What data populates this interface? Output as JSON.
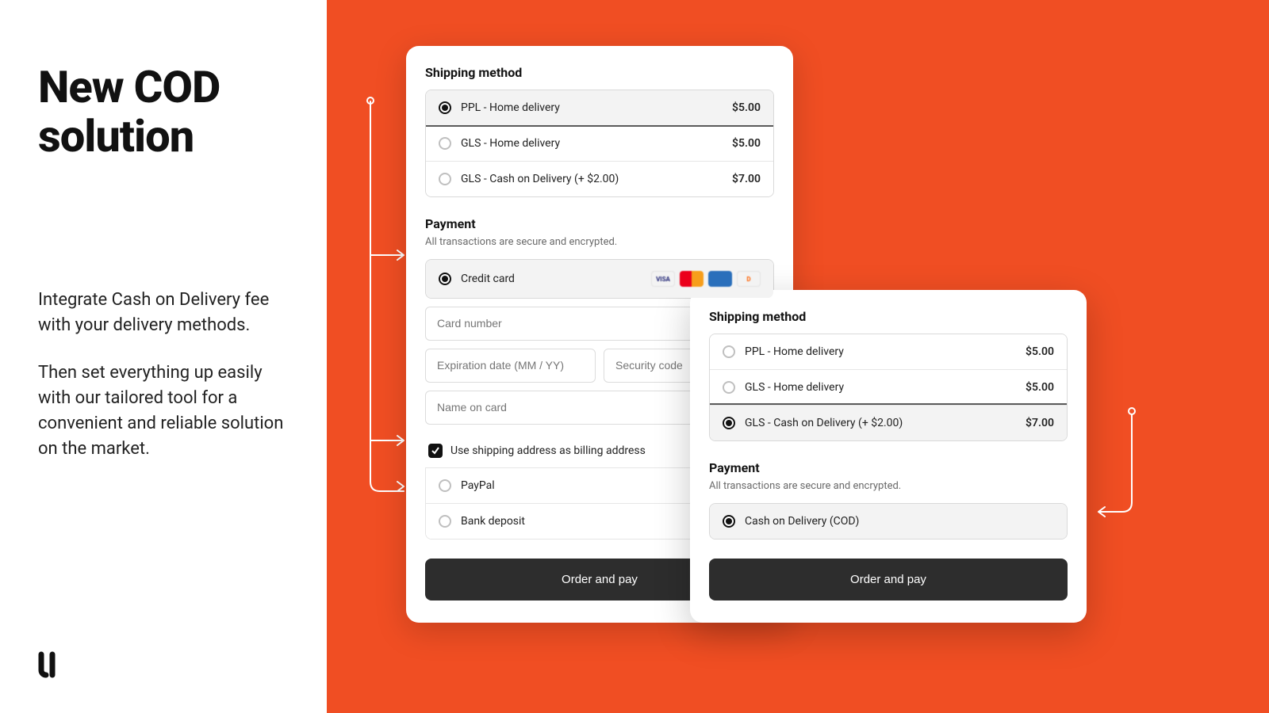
{
  "left": {
    "headline": "New COD solution",
    "p1": "Integrate Cash on Delivery fee with your delivery methods.",
    "p2": "Then set everything up easily with our tailored tool for a convenient and reliable solution on the market."
  },
  "cardA": {
    "shipping_title": "Shipping method",
    "shipping": [
      {
        "label": "PPL - Home delivery",
        "price": "$5.00",
        "selected": true
      },
      {
        "label": "GLS - Home delivery",
        "price": "$5.00",
        "selected": false
      },
      {
        "label": "GLS - Cash on Delivery (+ $2.00)",
        "price": "$7.00",
        "selected": false
      }
    ],
    "payment_title": "Payment",
    "payment_sub": "All transactions are secure and encrypted.",
    "cc_label": "Credit card",
    "fields": {
      "card_number": "Card number",
      "exp": "Expiration date (MM / YY)",
      "cvv": "Security code",
      "name": "Name on card"
    },
    "chk_label": "Use shipping address as billing address",
    "alt": [
      {
        "label": "PayPal"
      },
      {
        "label": "Bank deposit"
      }
    ],
    "cta": "Order and pay"
  },
  "cardB": {
    "shipping_title": "Shipping method",
    "shipping": [
      {
        "label": "PPL - Home delivery",
        "price": "$5.00",
        "selected": false
      },
      {
        "label": "GLS - Home delivery",
        "price": "$5.00",
        "selected": false
      },
      {
        "label": "GLS - Cash on Delivery (+ $2.00)",
        "price": "$7.00",
        "selected": true
      }
    ],
    "payment_title": "Payment",
    "payment_sub": "All transactions are secure and encrypted.",
    "cod_label": "Cash on Delivery (COD)",
    "cta": "Order and pay"
  },
  "colors": {
    "accent": "#F04E23"
  }
}
